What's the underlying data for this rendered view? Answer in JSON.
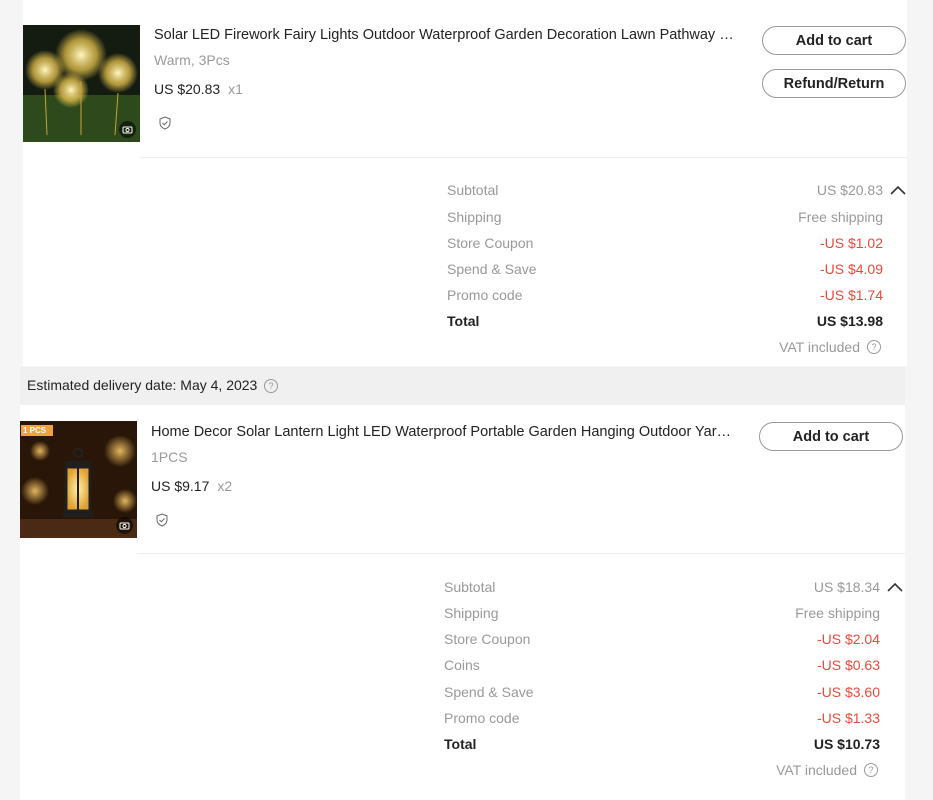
{
  "order1": {
    "item": {
      "title": "Solar LED Firework Fairy Lights Outdoor Waterproof Garden Decoration Lawn Pathway Sol...",
      "variant": "Warm, 3Pcs",
      "price": "US $20.83",
      "qty": "x1"
    },
    "actions": {
      "add_to_cart": "Add to cart",
      "refund": "Refund/Return"
    },
    "summary": [
      {
        "label": "Subtotal",
        "value": "US $20.83",
        "kind": "normal"
      },
      {
        "label": "Shipping",
        "value": "Free shipping",
        "kind": "normal"
      },
      {
        "label": "Store Coupon",
        "value": "-US $1.02",
        "kind": "neg"
      },
      {
        "label": "Spend & Save",
        "value": "-US $4.09",
        "kind": "neg"
      },
      {
        "label": "Promo code",
        "value": "-US $1.74",
        "kind": "neg"
      },
      {
        "label": "Total",
        "value": "US $13.98",
        "kind": "total"
      }
    ],
    "vat": "VAT included"
  },
  "delivery": {
    "text": "Estimated delivery date: May 4, 2023"
  },
  "order2": {
    "item": {
      "badge": "1 PCS",
      "title": "Home Decor Solar Lantern Light LED Waterproof Portable Garden Hanging Outdoor Yard ...",
      "variant": "1PCS",
      "price": "US $9.17",
      "qty": "x2"
    },
    "actions": {
      "add_to_cart": "Add to cart"
    },
    "summary": [
      {
        "label": "Subtotal",
        "value": "US $18.34",
        "kind": "normal"
      },
      {
        "label": "Shipping",
        "value": "Free shipping",
        "kind": "normal"
      },
      {
        "label": "Store Coupon",
        "value": "-US $2.04",
        "kind": "neg"
      },
      {
        "label": "Coins",
        "value": "-US $0.63",
        "kind": "neg"
      },
      {
        "label": "Spend & Save",
        "value": "-US $3.60",
        "kind": "neg"
      },
      {
        "label": "Promo code",
        "value": "-US $1.33",
        "kind": "neg"
      },
      {
        "label": "Total",
        "value": "US $10.73",
        "kind": "total"
      }
    ],
    "vat": "VAT included"
  },
  "icons": {
    "camera": "camera-icon",
    "shield": "shield-check-icon",
    "caret": "chevron-up-icon",
    "help": "help-circle-icon"
  },
  "colors": {
    "negative": "#e84a3c",
    "muted": "#999999",
    "text": "#222222"
  }
}
